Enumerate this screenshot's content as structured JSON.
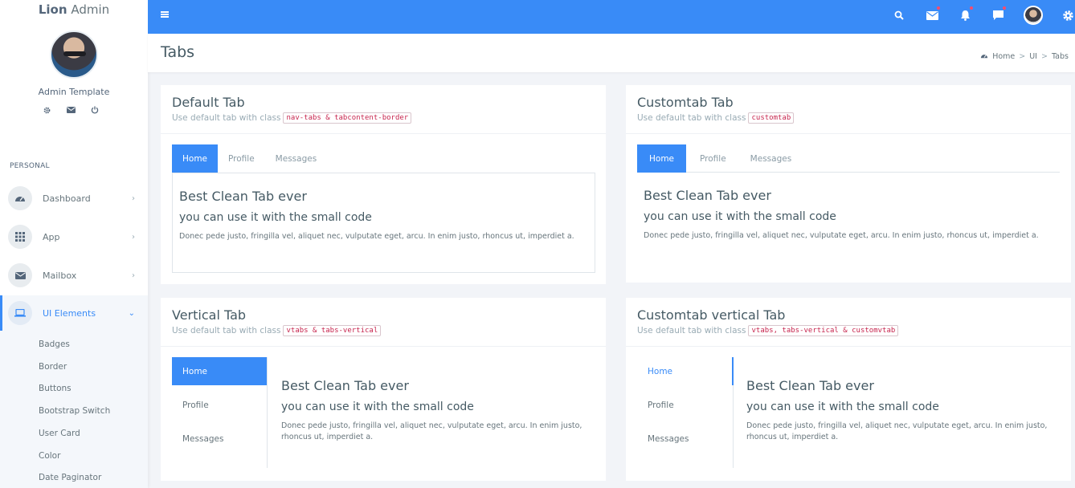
{
  "brand": {
    "bold": "Lion",
    "light": "Admin"
  },
  "user": {
    "name": "Admin Template"
  },
  "sidebar": {
    "section": "PERSONAL",
    "items": [
      {
        "label": "Dashboard",
        "arrow": "›"
      },
      {
        "label": "App",
        "arrow": "›"
      },
      {
        "label": "Mailbox",
        "arrow": "›"
      },
      {
        "label": "UI Elements",
        "arrow": "⌄"
      }
    ],
    "sub_items": [
      "Badges",
      "Border",
      "Buttons",
      "Bootstrap Switch",
      "User Card",
      "Color",
      "Date Paginator"
    ]
  },
  "header": {
    "page_title": "Tabs",
    "breadcrumb": [
      "Home",
      "UI",
      "Tabs"
    ],
    "breadcrumb_sep": ">"
  },
  "colors": {
    "primary": "#398bf7",
    "sidebar_bg": "#ffffff",
    "page_bg": "#f2f4f8",
    "badge_dot": "#fc4b6c"
  },
  "tab_labels": {
    "home": "Home",
    "profile": "Profile",
    "messages": "Messages"
  },
  "content": {
    "title": "Best Clean Tab ever",
    "subtitle": "you can use it with the small code",
    "body": "Donec pede justo, fringilla vel, aliquet nec, vulputate eget, arcu. In enim justo, rhoncus ut, imperdiet a."
  },
  "cards": {
    "default": {
      "title": "Default Tab",
      "sub": "Use default tab with class",
      "code": "nav-tabs & tabcontent-border"
    },
    "custom": {
      "title": "Customtab Tab",
      "sub": "Use default tab with class",
      "code": "customtab"
    },
    "vertical": {
      "title": "Vertical Tab",
      "sub": "Use default tab with class",
      "code": "vtabs & tabs-vertical"
    },
    "custom_vertical": {
      "title": "Customtab vertical Tab",
      "sub": "Use default tab with class",
      "code": "vtabs, tabs-vertical & customvtab"
    }
  }
}
